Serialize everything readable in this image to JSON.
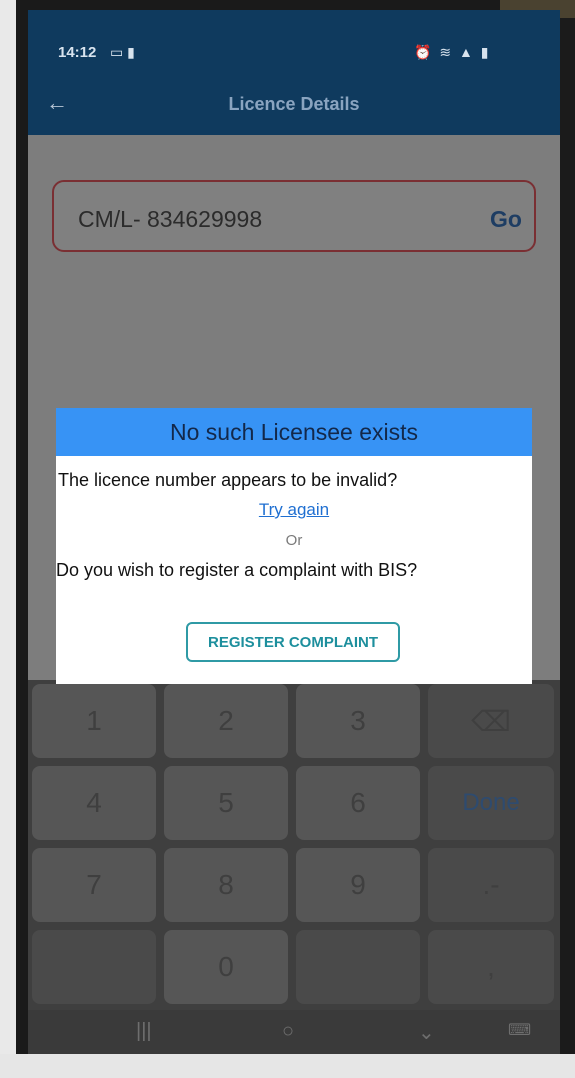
{
  "status_bar": {
    "time": "14:12",
    "notif_icons": "▭ ▮",
    "right_icons": "⏰ ≋ ▲ ▮"
  },
  "app_bar": {
    "back_icon": "arrow-left-icon",
    "title": "Licence Details"
  },
  "search": {
    "value": "CM/L- 834629998",
    "go_label": "Go"
  },
  "dialog": {
    "title": "No such Licensee exists",
    "message_invalid": "The licence number appears to be invalid?",
    "try_again": "Try again",
    "or_text": "Or",
    "message_register": "Do you wish to register a complaint with BIS?",
    "register_button": "REGISTER COMPLAINT"
  },
  "keyboard": {
    "row1": [
      "1",
      "2",
      "3",
      "⌫"
    ],
    "row2": [
      "4",
      "5",
      "6",
      "Done"
    ],
    "row3": [
      "7",
      "8",
      "9",
      ".-"
    ],
    "row4": [
      "",
      "0",
      "",
      ","
    ]
  },
  "nav": {
    "recent": "|||",
    "home": "○",
    "back": "⌄",
    "keyboard": "⌨"
  },
  "colors": {
    "app_bar": "#0f3a5e",
    "dialog_header": "#3793f5",
    "accent_teal": "#2f9aa5",
    "input_border": "#7a2f33"
  }
}
